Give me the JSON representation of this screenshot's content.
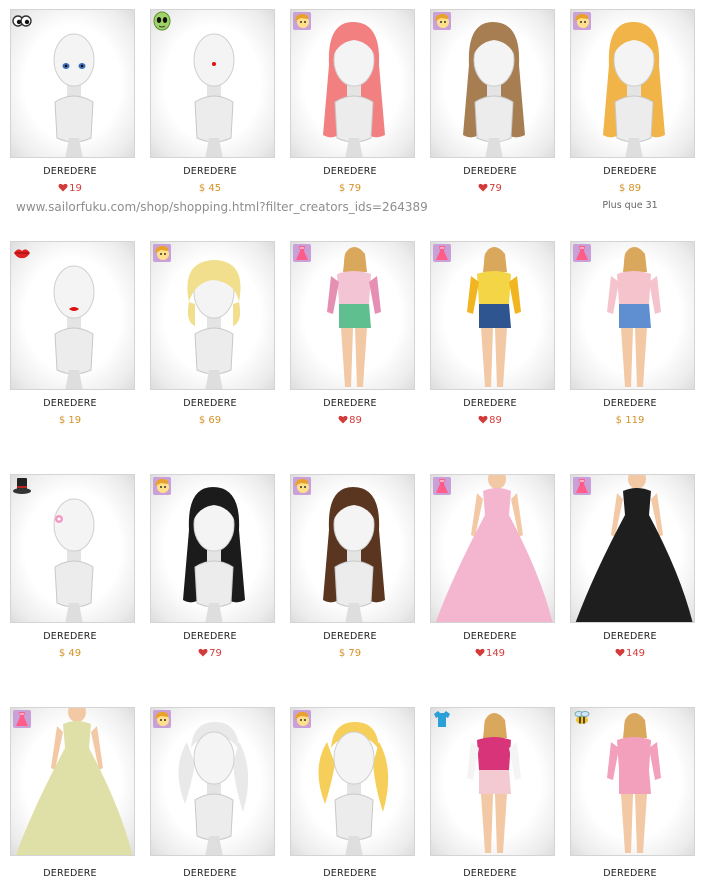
{
  "watermark_url": "www.sailorfuku.com/shop/shopping.html?filter_creators_ids=264389",
  "colors": {
    "gold_price": "#d49226",
    "heart_price": "#d33a3a",
    "border": "#d4d4d4"
  },
  "rows": [
    [
      {
        "name": "DEREDERE",
        "price": "19",
        "currency": "heart",
        "icon": "eyes-icon",
        "figure": "bust",
        "feature": "eyes"
      },
      {
        "name": "DEREDERE",
        "price": "$ 45",
        "currency": "dollar",
        "icon": "alien-face-icon",
        "figure": "bust",
        "feature": "dot"
      },
      {
        "name": "DEREDERE",
        "price": "$ 79",
        "currency": "dollar",
        "icon": "hair-face-icon",
        "figure": "bust",
        "hair": "#f28080",
        "hairStyle": "long"
      },
      {
        "name": "DEREDERE",
        "price": "79",
        "currency": "heart",
        "icon": "hair-face-icon",
        "figure": "bust",
        "hair": "#a77e52",
        "hairStyle": "long"
      },
      {
        "name": "DEREDERE",
        "price": "$ 89",
        "currency": "dollar",
        "icon": "hair-face-icon",
        "figure": "bust",
        "hair": "#f1b448",
        "hairStyle": "long",
        "more": "Plus que 31"
      }
    ],
    [
      {
        "name": "DEREDERE",
        "price": "$ 19",
        "currency": "dollar",
        "icon": "lips-icon",
        "figure": "bust",
        "feature": "lips"
      },
      {
        "name": "DEREDERE",
        "price": "$ 69",
        "currency": "dollar",
        "icon": "hair-face-icon",
        "figure": "bust",
        "hair": "#f2df8e",
        "hairStyle": "short"
      },
      {
        "name": "DEREDERE",
        "price": "89",
        "currency": "heart",
        "icon": "dress-icon",
        "figure": "outfit",
        "top": "#f3c4d3",
        "bottom": "#5fbf8e",
        "accent": "#e58fb3"
      },
      {
        "name": "DEREDERE",
        "price": "89",
        "currency": "heart",
        "icon": "dress-icon",
        "figure": "outfit",
        "top": "#f4d545",
        "bottom": "#2f5590",
        "accent": "#f2b522"
      },
      {
        "name": "DEREDERE",
        "price": "$ 119",
        "currency": "dollar",
        "icon": "dress-icon",
        "figure": "outfit",
        "top": "#f5c3cc",
        "bottom": "#5f8fd0",
        "accent": "#f5c3cc"
      }
    ],
    [
      {
        "name": "DEREDERE",
        "price": "$ 49",
        "currency": "dollar",
        "icon": "top-hat-icon",
        "figure": "bust",
        "feature": "flower"
      },
      {
        "name": "DEREDERE",
        "price": "79",
        "currency": "heart",
        "icon": "hair-face-icon",
        "figure": "bust",
        "hair": "#1b1b1b",
        "hairStyle": "long"
      },
      {
        "name": "DEREDERE",
        "price": "$ 79",
        "currency": "dollar",
        "icon": "hair-face-icon",
        "figure": "bust",
        "hair": "#5a3520",
        "hairStyle": "long"
      },
      {
        "name": "DEREDERE",
        "price": "149",
        "currency": "heart",
        "icon": "dress-icon",
        "figure": "gown",
        "gown": "#f4b6cf"
      },
      {
        "name": "DEREDERE",
        "price": "149",
        "currency": "heart",
        "icon": "dress-icon",
        "figure": "gown",
        "gown": "#1e1e1e"
      }
    ],
    [
      {
        "name": "DEREDERE",
        "price": "",
        "currency": "none",
        "icon": "dress-icon",
        "figure": "gown",
        "gown": "#dfe0a8"
      },
      {
        "name": "DEREDERE",
        "price": "",
        "currency": "none",
        "icon": "hair-face-icon",
        "figure": "bust",
        "hair": "#e9e9e9",
        "hairStyle": "pony"
      },
      {
        "name": "DEREDERE",
        "price": "",
        "currency": "none",
        "icon": "hair-face-icon",
        "figure": "bust",
        "hair": "#f6cf5a",
        "hairStyle": "pony"
      },
      {
        "name": "DEREDERE",
        "price": "",
        "currency": "none",
        "icon": "shirt-icon",
        "figure": "outfit",
        "top": "#d8347a",
        "bottom": "#f3c9d2",
        "accent": "#f4f4f4"
      },
      {
        "name": "DEREDERE",
        "price": "",
        "currency": "none",
        "icon": "bee-icon",
        "figure": "outfit",
        "top": "#f3a0bd",
        "bottom": "#f3a0bd",
        "accent": "#f3a0bd"
      }
    ]
  ]
}
